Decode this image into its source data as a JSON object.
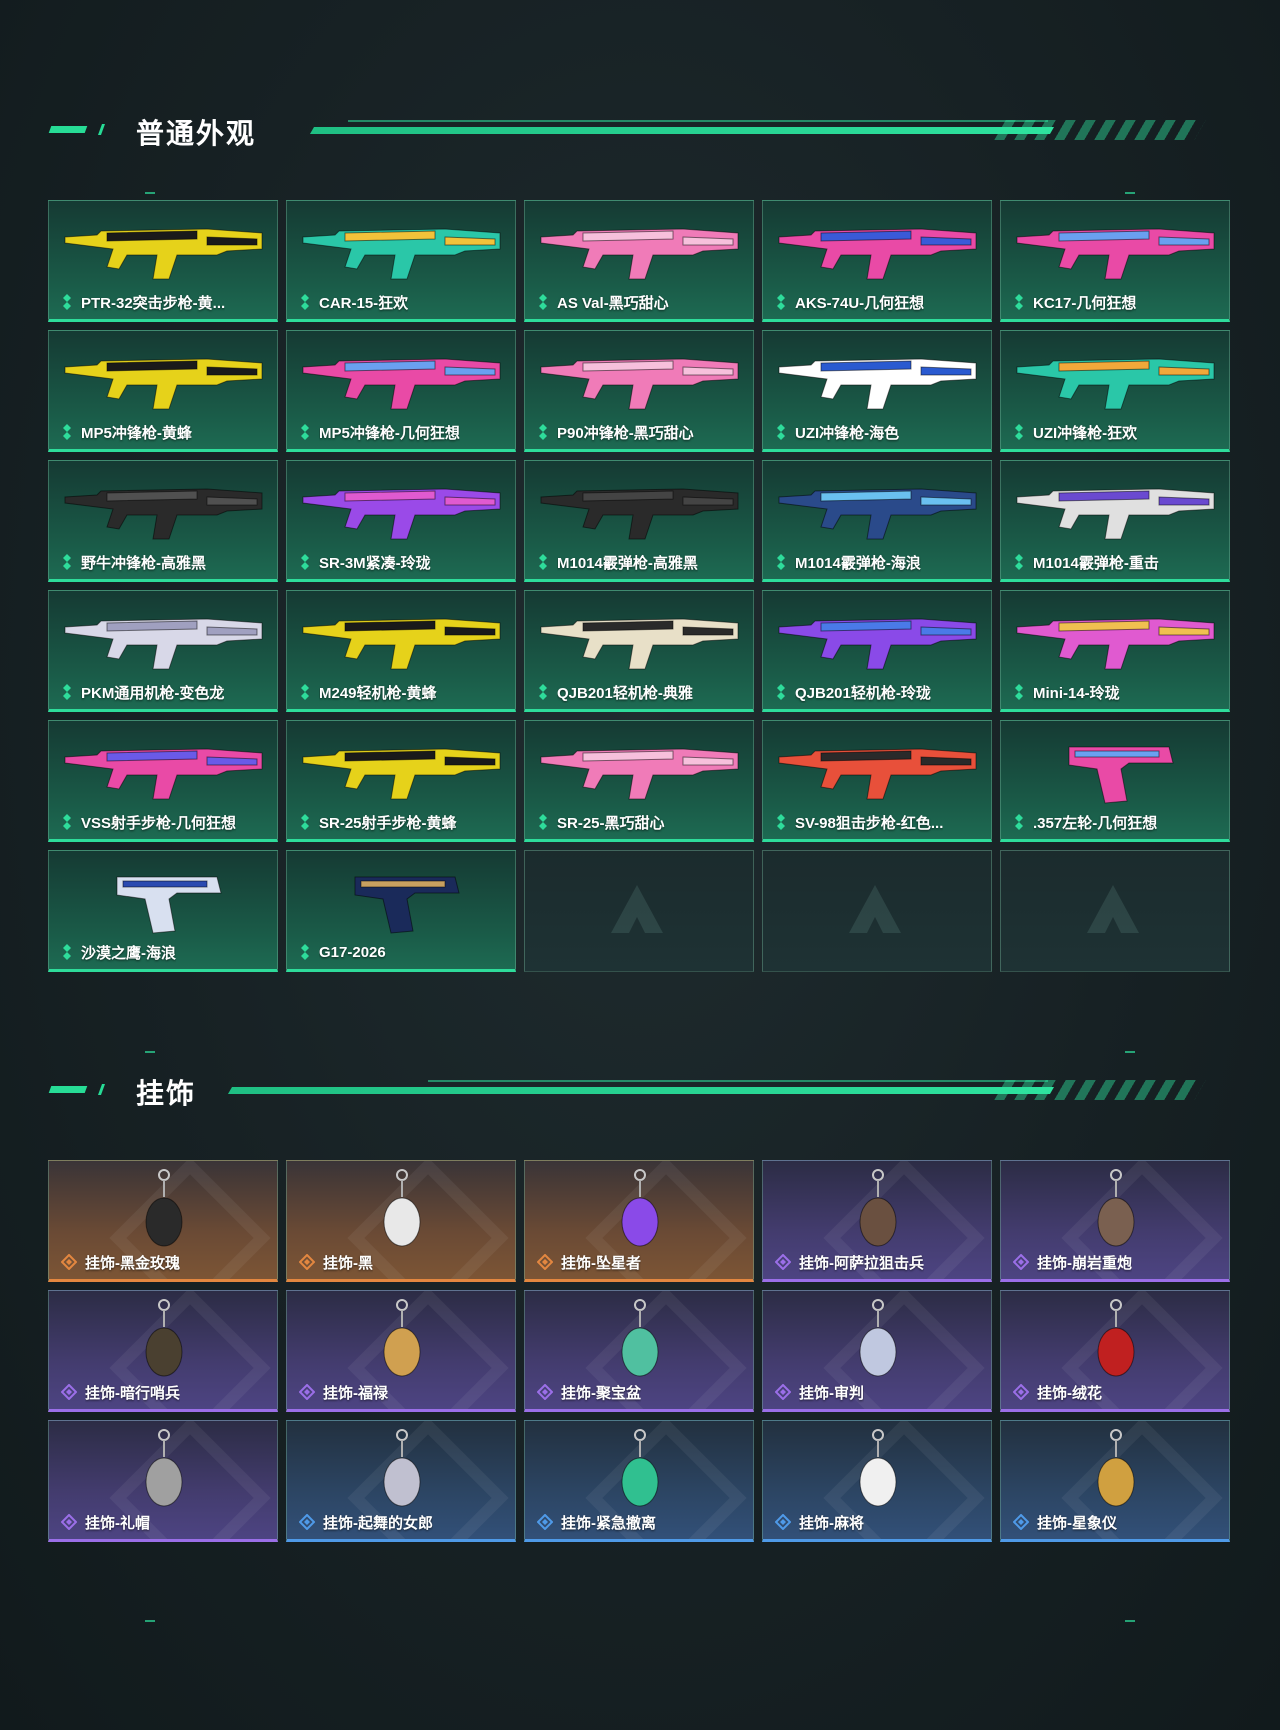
{
  "colors": {
    "accent": "#2edc9b",
    "rarity_green": "#2edc9b",
    "rarity_orange": "#e38740",
    "rarity_purple": "#9b6fe8",
    "rarity_blue": "#4f9ae8"
  },
  "sections": {
    "skins": {
      "title": "普通外观"
    },
    "charms": {
      "title": "挂饰"
    }
  },
  "weapons": [
    {
      "label": "PTR-32突击步枪-黄...",
      "colors": [
        "#e6d21a",
        "#1a1a1a"
      ]
    },
    {
      "label": "CAR-15-狂欢",
      "colors": [
        "#2ac7a8",
        "#f2c23a"
      ]
    },
    {
      "label": "AS Val-黑巧甜心",
      "colors": [
        "#f07bb8",
        "#f7c0dc"
      ]
    },
    {
      "label": "AKS-74U-几何狂想",
      "colors": [
        "#e94aa6",
        "#3a5ad8"
      ]
    },
    {
      "label": "KC17-几何狂想",
      "colors": [
        "#e94aa6",
        "#6aa0f0"
      ]
    },
    {
      "label": "MP5冲锋枪-黄蜂",
      "colors": [
        "#e6d21a",
        "#1a1a1a"
      ]
    },
    {
      "label": "MP5冲锋枪-几何狂想",
      "colors": [
        "#e94aa6",
        "#6aa0f0"
      ]
    },
    {
      "label": "P90冲锋枪-黑巧甜心",
      "colors": [
        "#f07bb8",
        "#f7c0dc"
      ]
    },
    {
      "label": "UZI冲锋枪-海色",
      "colors": [
        "#ffffff",
        "#2a5ad0"
      ]
    },
    {
      "label": "UZI冲锋枪-狂欢",
      "colors": [
        "#2ac7a8",
        "#f2a83a"
      ]
    },
    {
      "label": "野牛冲锋枪-高雅黑",
      "colors": [
        "#2a2a2a",
        "#505050"
      ]
    },
    {
      "label": "SR-3M紧凑-玲珑",
      "colors": [
        "#9a4ae8",
        "#e05ad0"
      ]
    },
    {
      "label": "M1014霰弹枪-高雅黑",
      "colors": [
        "#2a2a2a",
        "#444444"
      ]
    },
    {
      "label": "M1014霰弹枪-海浪",
      "colors": [
        "#2a4a8a",
        "#6ac0f0"
      ]
    },
    {
      "label": "M1014霰弹枪-重击",
      "colors": [
        "#e0e0e0",
        "#6a4ad0"
      ]
    },
    {
      "label": "PKM通用机枪-变色龙",
      "colors": [
        "#d8d8e8",
        "#a0a0c0"
      ]
    },
    {
      "label": "M249轻机枪-黄蜂",
      "colors": [
        "#e6d21a",
        "#1a1a1a"
      ]
    },
    {
      "label": "QJB201轻机枪-典雅",
      "colors": [
        "#e8e0c8",
        "#2a2a2a"
      ]
    },
    {
      "label": "QJB201轻机枪-玲珑",
      "colors": [
        "#8a4ae8",
        "#4a7ae8"
      ]
    },
    {
      "label": "Mini-14-玲珑",
      "colors": [
        "#e05ad0",
        "#f0c050"
      ]
    },
    {
      "label": "VSS射手步枪-几何狂想",
      "colors": [
        "#e94aa6",
        "#6a5ae8"
      ]
    },
    {
      "label": "SR-25射手步枪-黄蜂",
      "colors": [
        "#e6d21a",
        "#1a1a1a"
      ]
    },
    {
      "label": "SR-25-黑巧甜心",
      "colors": [
        "#f07bb8",
        "#f7c0dc"
      ]
    },
    {
      "label": "SV-98狙击步枪-红色...",
      "colors": [
        "#e8503a",
        "#2a2a2a"
      ]
    },
    {
      "label": ".357左轮-几何狂想",
      "colors": [
        "#e94aa6",
        "#6aa0f0"
      ]
    },
    {
      "label": "沙漠之鹰-海浪",
      "colors": [
        "#d8e0f0",
        "#2a4ab0"
      ]
    },
    {
      "label": "G17-2026",
      "colors": [
        "#1a2a5a",
        "#c8a060"
      ]
    }
  ],
  "empty_slots": 3,
  "charms": [
    {
      "label": "挂饰-黑金玫瑰",
      "rarity": "orange",
      "color": "#2a2a2a"
    },
    {
      "label": "挂饰-黑",
      "rarity": "orange",
      "color": "#e8e8e8"
    },
    {
      "label": "挂饰-坠星者",
      "rarity": "orange",
      "color": "#8a4ae8"
    },
    {
      "label": "挂饰-阿萨拉狙击兵",
      "rarity": "purple",
      "color": "#6a5040"
    },
    {
      "label": "挂饰-崩岩重炮",
      "rarity": "purple",
      "color": "#7a6050"
    },
    {
      "label": "挂饰-暗行哨兵",
      "rarity": "purple",
      "color": "#4a4030"
    },
    {
      "label": "挂饰-福禄",
      "rarity": "purple",
      "color": "#d0a050"
    },
    {
      "label": "挂饰-聚宝盆",
      "rarity": "purple",
      "color": "#50c0a0"
    },
    {
      "label": "挂饰-审判",
      "rarity": "purple",
      "color": "#c0c8e0"
    },
    {
      "label": "挂饰-绒花",
      "rarity": "purple",
      "color": "#c02020"
    },
    {
      "label": "挂饰-礼帽",
      "rarity": "purple",
      "color": "#a0a0a0"
    },
    {
      "label": "挂饰-起舞的女郎",
      "rarity": "blue",
      "color": "#c0c0d0"
    },
    {
      "label": "挂饰-紧急撤离",
      "rarity": "blue",
      "color": "#30c090"
    },
    {
      "label": "挂饰-麻将",
      "rarity": "blue",
      "color": "#f0f0f0"
    },
    {
      "label": "挂饰-星象仪",
      "rarity": "blue",
      "color": "#d0a040"
    }
  ]
}
